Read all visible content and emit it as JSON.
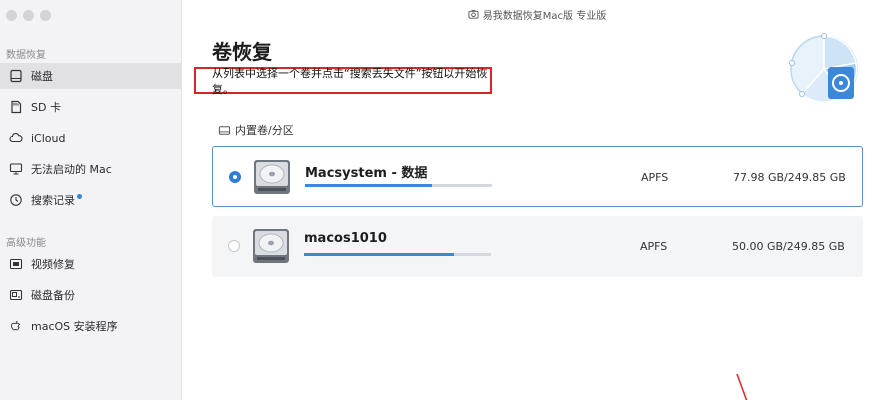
{
  "window": {
    "title": "易我数据恢复Mac版  专业版"
  },
  "sidebar": {
    "section_recovery": "数据恢复",
    "section_advanced": "高级功能",
    "items": [
      {
        "label": "磁盘",
        "icon": "disk-icon",
        "active": true
      },
      {
        "label": "SD 卡",
        "icon": "sd-card-icon"
      },
      {
        "label": "iCloud",
        "icon": "cloud-icon"
      },
      {
        "label": "无法启动的 Mac",
        "icon": "mac-icon"
      },
      {
        "label": "搜索记录",
        "icon": "history-icon",
        "badge": true
      }
    ],
    "advanced_items": [
      {
        "label": "视频修复",
        "icon": "video-icon"
      },
      {
        "label": "磁盘备份",
        "icon": "backup-icon"
      },
      {
        "label": "macOS 安装程序",
        "icon": "apple-icon"
      }
    ]
  },
  "main": {
    "title": "卷恢复",
    "instruction": "从列表中选择一个卷并点击“搜索丢失文件”按钮以开始恢复。",
    "group_label": "内置卷/分区",
    "volumes": [
      {
        "name": "Macsystem - 数据",
        "fs": "APFS",
        "size": "77.98 GB/249.85 GB",
        "used_fraction": 0.68,
        "selected": true
      },
      {
        "name": "macos1010",
        "fs": "APFS",
        "size": "50.00 GB/249.85 GB",
        "used_fraction": 0.8,
        "selected": false
      }
    ]
  },
  "colors": {
    "accent": "#2e7dd6",
    "highlight_box": "#d62828",
    "sidebar_bg": "#f3f3f5"
  }
}
